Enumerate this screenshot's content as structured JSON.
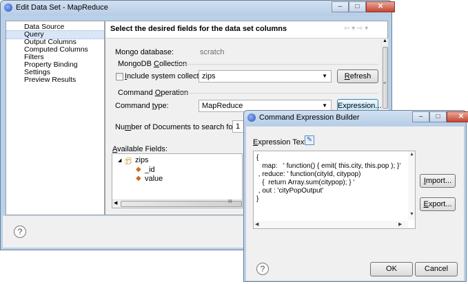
{
  "main_window": {
    "title": "Edit Data Set - MapReduce",
    "sidebar": [
      "Data Source",
      "Query",
      "Output Columns",
      "Computed Columns",
      "Filters",
      "Property Binding",
      "Settings",
      "Preview Results"
    ],
    "selected_sidebar": "Query",
    "header": "Select the desired fields for the data set columns",
    "mongo_db_label": "Mongo database:",
    "mongo_db_value": "scratch",
    "collection_group": "MongoDB Collection",
    "include_system_prefix": "",
    "include_system_label": "Include system collection",
    "collection_value": "zips",
    "refresh_label": "Refresh",
    "command_group": "Command Operation",
    "command_type_label": "Command type:",
    "command_type_value": "MapReduce",
    "expression_button": "Expression...",
    "num_docs_label": "Number of Documents to search for fields:",
    "num_docs_value": "1",
    "available_fields_label": "Available Fields:",
    "tree": {
      "root": "zips",
      "children": [
        "_id",
        "value"
      ]
    },
    "scroll_mark": "III"
  },
  "dialog": {
    "title": "Command Expression Builder",
    "expression_label": "Expression Text:",
    "expression_text": "{\n   map:   ' function() { emit( this.city, this.pop ); }'\n , reduce: ' function(cityId, citypop)\n   {  return Array.sum(citypop); } '\n , out : 'cityPopOutput'\n}",
    "import_label": "Import...",
    "export_label": "Export...",
    "ok_label": "OK",
    "cancel_label": "Cancel"
  },
  "colors": {
    "frame": "#b9d1ea",
    "panel": "#f0f0f0",
    "selection": "#d9e6f7",
    "close_button": "#c7442f"
  }
}
